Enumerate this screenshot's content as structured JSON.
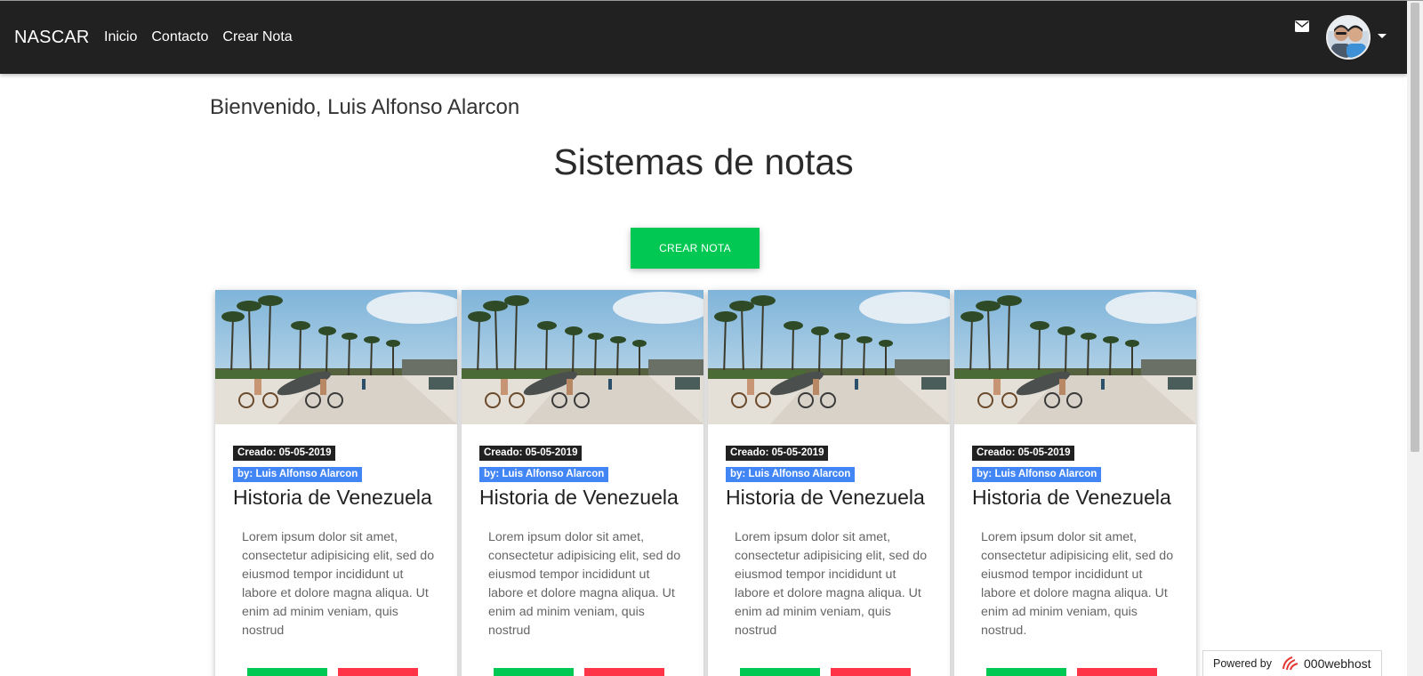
{
  "navbar": {
    "brand": "NASCAR",
    "links": [
      {
        "label": "Inicio"
      },
      {
        "label": "Contacto"
      },
      {
        "label": "Crear Nota"
      }
    ],
    "icons": {
      "mail": "envelope-icon",
      "avatar": "user-avatar",
      "dropdown": "caret-down-icon"
    }
  },
  "main": {
    "welcome": "Bienvenido, Luis Alfonso Alarcon",
    "title": "Sistemas de notas",
    "create_button": "CREAR NOTA"
  },
  "cards": [
    {
      "created": "Creado: 05-05-2019",
      "author": "by: Luis Alfonso Alarcon",
      "title": "Historia de Venezuela",
      "text": "Lorem ipsum dolor sit amet, consectetur adipisicing elit, sed do eiusmod tempor incididunt ut labore et dolore magna aliqua. Ut enim ad minim veniam, quis nostrud"
    },
    {
      "created": "Creado: 05-05-2019",
      "author": "by: Luis Alfonso Alarcon",
      "title": "Historia de Venezuela",
      "text": "Lorem ipsum dolor sit amet, consectetur adipisicing elit, sed do eiusmod tempor incididunt ut labore et dolore magna aliqua. Ut enim ad minim veniam, quis nostrud"
    },
    {
      "created": "Creado: 05-05-2019",
      "author": "by: Luis Alfonso Alarcon",
      "title": "Historia de Venezuela",
      "text": "Lorem ipsum dolor sit amet, consectetur adipisicing elit, sed do eiusmod tempor incididunt ut labore et dolore magna aliqua. Ut enim ad minim veniam, quis nostrud"
    },
    {
      "created": "Creado: 05-05-2019",
      "author": "by: Luis Alfonso Alarcon",
      "title": "Historia de Venezuela",
      "text": "Lorem ipsum dolor sit amet, consectetur adipisicing elit, sed do eiusmod tempor incididunt ut labore et dolore magna aliqua. Ut enim ad minim veniam, quis nostrud."
    }
  ],
  "footer_badge": {
    "label": "Powered by",
    "brand": "000webhost"
  },
  "colors": {
    "navbar": "#212121",
    "primary_green": "#00c853",
    "danger_red": "#ff3547",
    "author_badge_blue": "#4285f4",
    "date_badge_dark": "#212121"
  }
}
